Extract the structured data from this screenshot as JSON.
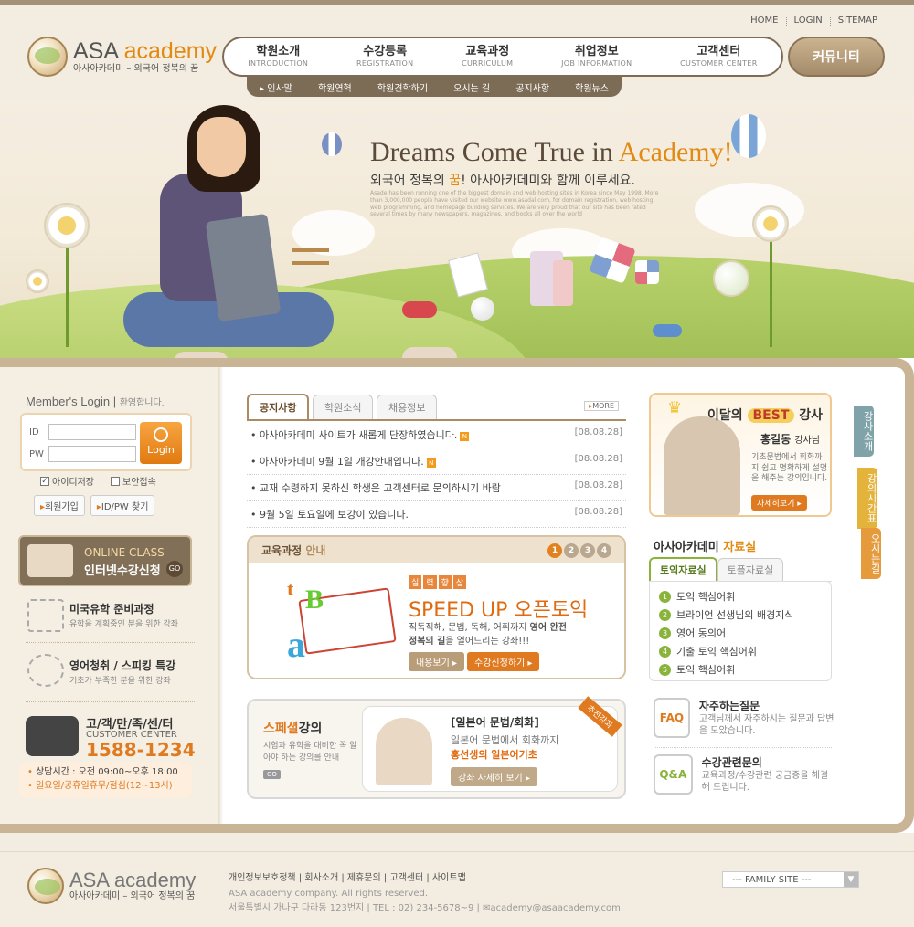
{
  "util_nav": [
    "HOME",
    "LOGIN",
    "SITEMAP"
  ],
  "logo": {
    "brand": "ASA",
    "brand2": "academy",
    "tagline": "아사아카데미 – 외국어 정복의 꿈",
    "badge": "World"
  },
  "gnb": [
    {
      "ko": "학원소개",
      "en": "INTRODUCTION"
    },
    {
      "ko": "수강등록",
      "en": "REGISTRATION"
    },
    {
      "ko": "교육과정",
      "en": "CURRICULUM"
    },
    {
      "ko": "취업정보",
      "en": "JOB INFORMATION"
    },
    {
      "ko": "고객센터",
      "en": "CUSTOMER CENTER"
    }
  ],
  "community": "커뮤니티",
  "subnav": [
    "인사말",
    "학원연혁",
    "학원견학하기",
    "오시는 길",
    "공지사항",
    "학원뉴스"
  ],
  "hero": {
    "title1": "Dreams Come True in ",
    "title2": "Academy!",
    "sub1": "외국어 정복의 ",
    "sub_em": "꿈",
    "sub2": "! 아사아카데미와 함께 이루세요.",
    "small": "Asade has been running one of the biggest domain and web hosting sites in Korea since May 1998. More than 3,000,000 people have visited our website www.asadal.com, for domain registration, web hosting, web programming, and homepage building services. We are very proud that our site has been rated several times by many newspapers, magazines, and books all over the world"
  },
  "login": {
    "title": "Member's Login",
    "greet": "환영합니다.",
    "id_label": "ID",
    "pw_label": "PW",
    "btn": "Login",
    "save_id": "아이디저장",
    "secure": "보안접속",
    "join": "회원가입",
    "find": "ID/PW 찾기"
  },
  "online": {
    "title": "ONLINE CLASS",
    "sub": "인터넷수강신청",
    "go": "GO"
  },
  "left_menus": [
    {
      "title": "미국유학 준비과정",
      "sub": "유학을 계획중인 분을 위한 강좌"
    },
    {
      "title": "영어청취 / 스피킹 특강",
      "sub": "기초가 부족한 분을 위한 강좌"
    }
  ],
  "cs": {
    "title": "고/객/만/족/센/터",
    "en": "CUSTOMER CENTER",
    "phone": "1588-1234",
    "hours1": "상담시간 : 오전 09:00~오후 18:00",
    "hours2": "일요일/공휴일휴무/점심(12~13시)"
  },
  "notice": {
    "tabs": [
      "공지사항",
      "학원소식",
      "채용정보"
    ],
    "more": "MORE",
    "new": "N",
    "rows": [
      {
        "t": "아사아카데미 사이트가 새롭게 단장하였습니다.",
        "d": "[08.08.28]",
        "new": true
      },
      {
        "t": "아사아카데미 9월 1일 개강안내입니다.",
        "d": "[08.08.28]",
        "new": true
      },
      {
        "t": "교재 수령하지 못하신 학생은 고객센터로 문의하시기 바람",
        "d": "[08.08.28]",
        "new": false
      },
      {
        "t": "9월 5일 토요일에 보강이 있습니다.",
        "d": "[08.08.28]",
        "new": false
      }
    ]
  },
  "course": {
    "head": "교육과정",
    "head2": "안내",
    "pages": [
      "1",
      "2",
      "3",
      "4"
    ],
    "badge": [
      "실",
      "력",
      "향",
      "상"
    ],
    "title1": "SPEED UP 오픈",
    "title2": "토익",
    "desc1": "직독직해, 문법, 독해, 어휘까지 ",
    "desc1b": "영어 완전",
    "desc2a": "정복의 길",
    "desc2b": "을 열어드리는 강좌!!!",
    "btn1": "내용보기",
    "btn2": "수강신청하기"
  },
  "special": {
    "title1": "스페셜",
    "title2": "강의",
    "desc": "시험과 유학을 대비한 꼭 알아야 하는 강의를 안내",
    "go": "GO",
    "badge": "추천강좌",
    "lecture": "[일본어 문법/회화]",
    "line1": "일본어 문법에서 회화까지",
    "line2": "홍선생의 일본어기초",
    "btn": "강좌 자세히 보기"
  },
  "best": {
    "t1": "이달의",
    "t2": "BEST",
    "t3": "강사",
    "name": "홍길동",
    "role": "강사님",
    "desc": "기초문법에서 회화까지 쉽고 명확하게 설명을 해주는 강의입니다.",
    "btn": "자세히보기"
  },
  "ref": {
    "title1": "아사아카데미 ",
    "title2": "자료실",
    "tabs": [
      "토익자료실",
      "토플자료실"
    ],
    "items": [
      "토익 핵심어휘",
      "브라이언 선생님의 배경지식",
      "영어 동의어",
      "기출 토익 핵심어휘",
      "토익 핵심어휘"
    ]
  },
  "faq": [
    {
      "title": "자주하는질문",
      "sub": "고객님께서 자주하시는 질문과 답변을 모았습니다."
    },
    {
      "title": "수강관련문의",
      "sub": "교육과정/수강관련 궁금증을 해결해 드립니다."
    }
  ],
  "side_tabs": [
    "강사소개",
    "강의시간표",
    "오시는길"
  ],
  "footer": {
    "links": [
      "개인정보보호정책",
      "회사소개",
      "제휴문의",
      "고객센터",
      "사이트맵"
    ],
    "company": "ASA academy company. All rights reserved.",
    "addr": "서울특별시 가나구 다라동 123번지  |  TEL : 02) 234-5678~9  |  ",
    "email": "academy@asaacademy.com",
    "family": "--- FAMILY SITE ---"
  }
}
